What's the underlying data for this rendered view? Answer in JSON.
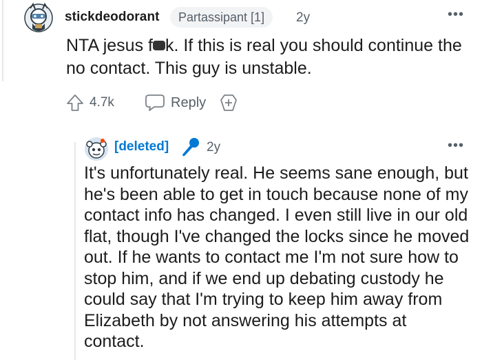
{
  "comment": {
    "username": "stickdeodorant",
    "flair": "Partassipant [1]",
    "age": "2y",
    "more_label": "•••",
    "body_before": "NTA jesus f",
    "body_after": "k. If this is real you should continue the no contact. This guy is unstable.",
    "score": "4.7k",
    "reply_label": "Reply",
    "avatar_icon": "snoo-avatar-icon",
    "upvote_icon": "upvote-arrow-icon",
    "reply_icon": "speech-bubble-icon",
    "award_icon": "add-award-icon"
  },
  "reply": {
    "username": "[deleted]",
    "age": "2y",
    "more_label": "•••",
    "body": "It's unfortunately real. He seems sane enough, but he's been able to get in touch because none of my contact info has changed. I even still live in our old flat, though I've changed the locks since he moved out. If he wants to contact me I'm not sure how to stop him, and if we end up debating custody he could say that I'm trying to keep him away from Elizabeth by not answering his attempts at contact.",
    "avatar_icon": "snoo-avatar-icon",
    "op_icon": "microphone-icon"
  },
  "colors": {
    "text": "#1c1c1c",
    "meta": "#576069",
    "deleted_user": "#0079d3",
    "flair_bg": "#f2f3f5"
  }
}
